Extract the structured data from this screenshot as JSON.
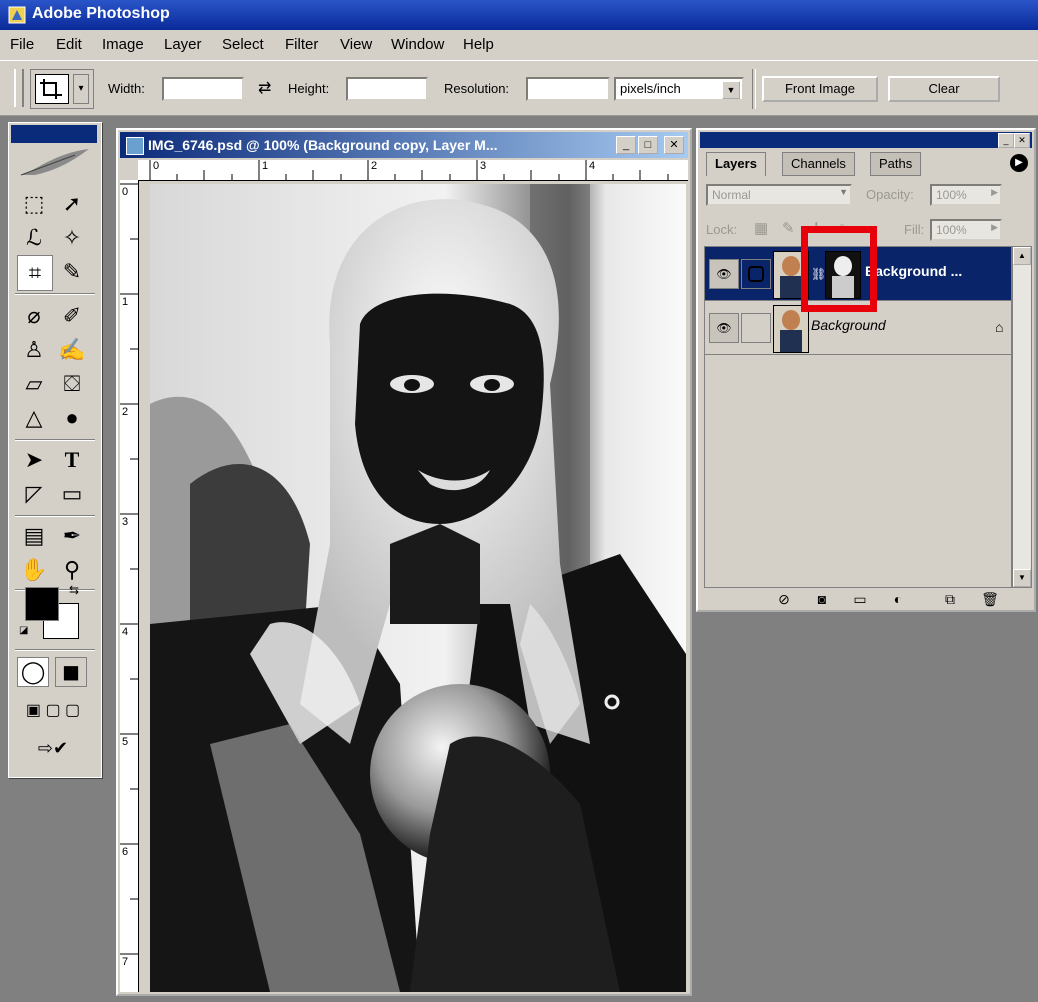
{
  "app": {
    "title": "Adobe Photoshop"
  },
  "menu": [
    "File",
    "Edit",
    "Image",
    "Layer",
    "Select",
    "Filter",
    "View",
    "Window",
    "Help"
  ],
  "options": {
    "width_label": "Width:",
    "height_label": "Height:",
    "resolution_label": "Resolution:",
    "resolution_unit": "pixels/inch",
    "front_image_button": "Front Image",
    "clear_button": "Clear"
  },
  "document": {
    "title": "IMG_6746.psd @ 100% (Background copy, Layer M...",
    "hruler": [
      "0",
      "1",
      "2",
      "3",
      "4"
    ],
    "vruler": [
      "0",
      "1",
      "2",
      "3",
      "4",
      "5",
      "6",
      "7"
    ]
  },
  "layers_panel": {
    "tabs": [
      "Layers",
      "Channels",
      "Paths"
    ],
    "blend_mode": "Normal",
    "opacity_label": "Opacity:",
    "opacity_value": "100%",
    "lock_label": "Lock:",
    "fill_label": "Fill:",
    "fill_value": "100%",
    "layers": [
      {
        "name": "Background ...",
        "selected": true
      },
      {
        "name": "Background",
        "selected": false,
        "locked": true
      }
    ]
  },
  "colors": {
    "title_bar": "#0a2a9a",
    "selected_layer": "#0a246a",
    "highlight_box": "#e8000a"
  }
}
